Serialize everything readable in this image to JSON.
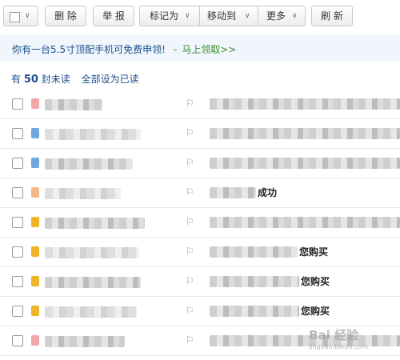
{
  "toolbar": {
    "select_all_caret": "∨",
    "delete_label": "删 除",
    "report_label": "举 报",
    "mark_as_label": "标记为",
    "move_to_label": "移动到",
    "more_label": "更多",
    "refresh_label": "刷 新",
    "caret": "∨"
  },
  "promo": {
    "text": "你有一台5.5寸顶配手机可免费申领!",
    "dash": "-",
    "link": "马上领取>>"
  },
  "summary": {
    "prefix": "有",
    "count": "50",
    "suffix": "封未读",
    "mark_all": "全部设为已读"
  },
  "mail_rows": [
    {
      "icon_color": "#f2a6a6",
      "subject_visible": ""
    },
    {
      "icon_color": "#6fa8dc",
      "subject_visible": ""
    },
    {
      "icon_color": "#6fa8dc",
      "subject_visible": ""
    },
    {
      "icon_color": "#f5b889",
      "subject_visible": "成功"
    },
    {
      "icon_color": "#f0b429",
      "subject_visible": ""
    },
    {
      "icon_color": "#f0b429",
      "subject_visible": "您购买"
    },
    {
      "icon_color": "#f0b429",
      "subject_visible": "您购买"
    },
    {
      "icon_color": "#f0b429",
      "subject_visible": "您购买"
    },
    {
      "icon_color": "#f2a6a6",
      "subject_visible": ""
    }
  ],
  "flag_icon": "⚐",
  "watermark": {
    "brand": "Bai 经验",
    "sub": "jingyan.baidu.com"
  },
  "colors": {
    "link_blue": "#1a4f8c",
    "promo_green": "#3c8a2e",
    "promo_bg": "#f0f6fc"
  }
}
